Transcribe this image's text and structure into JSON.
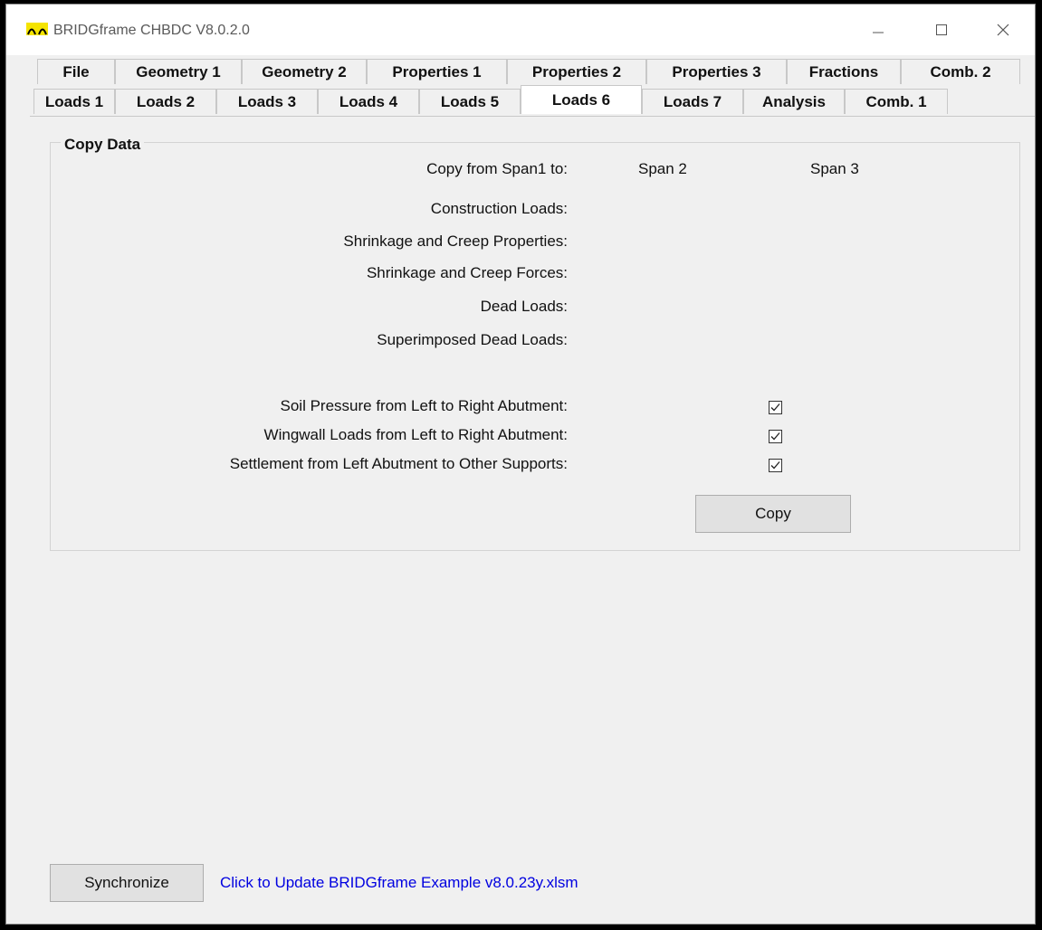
{
  "window": {
    "title": "BRIDGframe CHBDC  V8.0.2.0",
    "controls": [
      "minimize-icon",
      "maximize-icon",
      "close-icon"
    ]
  },
  "tabs": {
    "row1": [
      "File",
      "Geometry 1",
      "Geometry 2",
      "Properties 1",
      "Properties 2",
      "Properties 3",
      "Fractions",
      "Comb. 2"
    ],
    "row2": [
      "Loads 1",
      "Loads 2",
      "Loads 3",
      "Loads 4",
      "Loads 5",
      "Loads 6",
      "Loads 7",
      "Analysis",
      "Comb. 1"
    ],
    "active": "Loads 6"
  },
  "copy_data": {
    "group_title": "Copy Data",
    "header_label": "Copy from Span1 to:",
    "span_columns": [
      "Span 2",
      "Span 3"
    ],
    "rows": [
      {
        "label": "Construction Loads:"
      },
      {
        "label": "Shrinkage and Creep Properties:"
      },
      {
        "label": "Shrinkage and Creep Forces:"
      },
      {
        "label": "Dead Loads:"
      },
      {
        "label": "Superimposed Dead Loads:"
      }
    ],
    "abutment_rows": [
      {
        "label": "Soil Pressure from Left to Right Abutment:",
        "checked": true
      },
      {
        "label": "Wingwall Loads from Left to Right Abutment:",
        "checked": true
      },
      {
        "label": "Settlement from Left Abutment to Other Supports:",
        "checked": true
      }
    ],
    "copy_button": "Copy"
  },
  "footer": {
    "synchronize_button": "Synchronize",
    "update_link": "Click to Update BRIDGframe Example v8.0.23y.xlsm"
  },
  "colors": {
    "link": "#0000e0",
    "icon_yellow": "#f5e400"
  }
}
